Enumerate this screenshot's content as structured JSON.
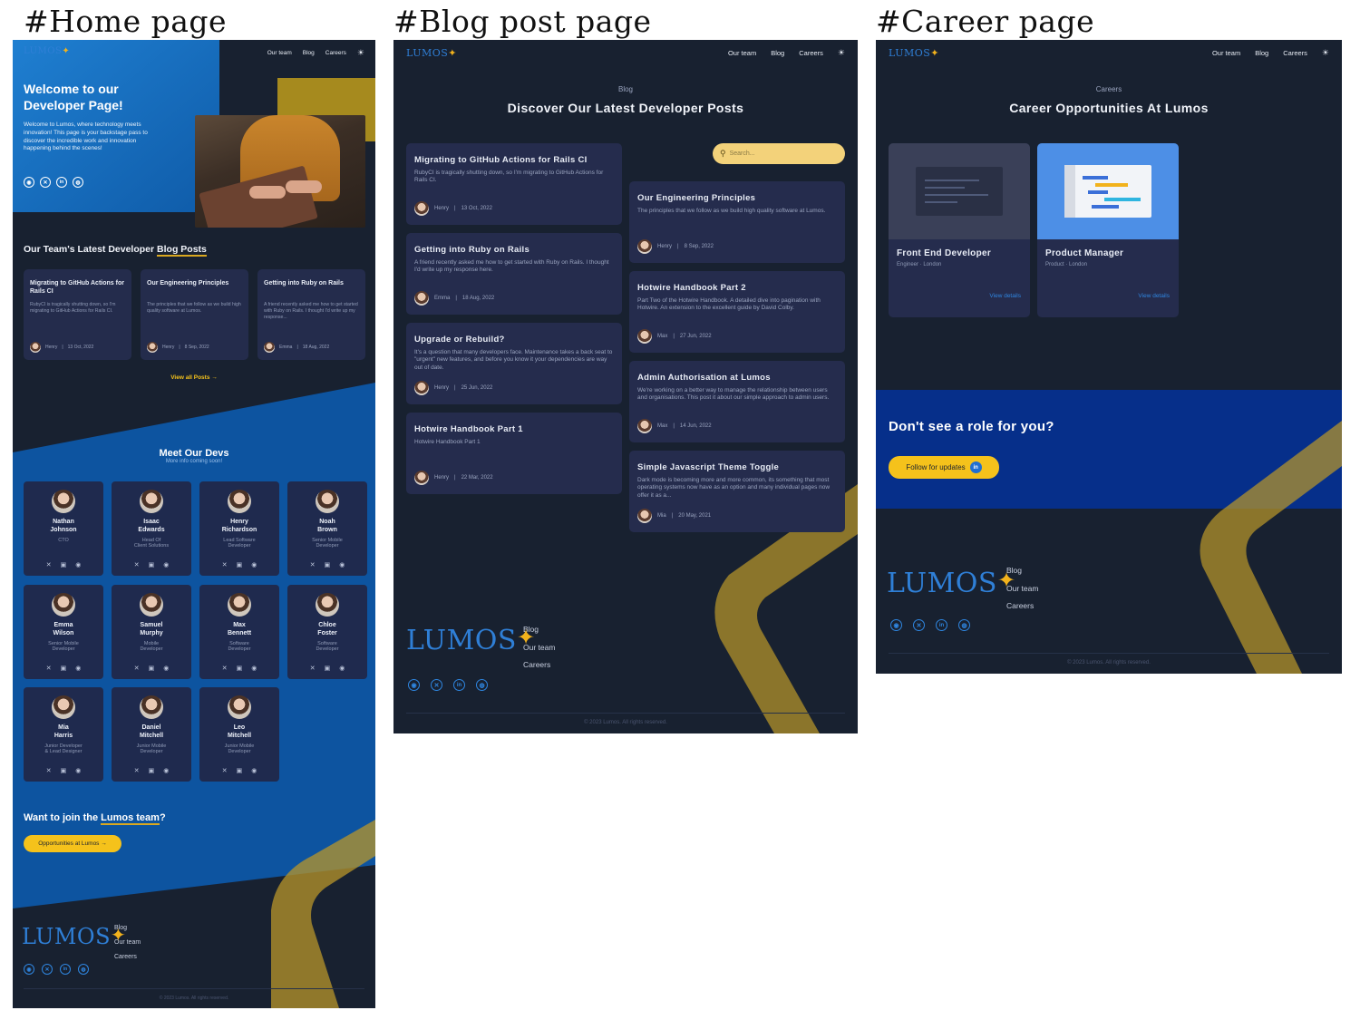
{
  "captions": {
    "home": "#Home page",
    "blog": "#Blog post page",
    "career": "#Career page"
  },
  "nav": {
    "our_team": "Our team",
    "blog": "Blog",
    "careers": "Careers",
    "theme_icon": "sun-icon"
  },
  "logo": {
    "text": "LUMOS",
    "star": "✦"
  },
  "home": {
    "hero_title_1": "Welcome to our",
    "hero_title_2": "Developer Page!",
    "hero_text": "Welcome to Lumos, where technology meets innovation! This page is your backstage pass to discover the incredible work and innovation happening behind the scenes!",
    "posts_heading_prefix": "Our Team's Latest Developer ",
    "posts_heading_highlight": "Blog Posts",
    "posts": [
      {
        "title": "Migrating to GitHub Actions for Rails CI",
        "excerpt": "RubyCI is tragically shutting down, so I'm migrating to GitHub Actions for Rails CI.",
        "author": "Henry",
        "date": "13 Oct, 2022"
      },
      {
        "title": "Our Engineering Principles",
        "excerpt": "The principles that we follow as we build high quality software at Lumos.",
        "author": "Henry",
        "date": "8 Sep, 2022"
      },
      {
        "title": "Getting into Ruby on Rails",
        "excerpt": "A friend recently asked me how to get started with Ruby on Rails. I thought I'd write up my response...",
        "author": "Emma",
        "date": "18 Aug, 2022"
      }
    ],
    "view_all": "View all Posts →",
    "devs_heading": "Meet Our Devs",
    "devs_subheading": "More info coming soon!",
    "devs": [
      {
        "first": "Nathan",
        "last": "Johnson",
        "role1": "CTO",
        "role2": ""
      },
      {
        "first": "Isaac",
        "last": "Edwards",
        "role1": "Head Of",
        "role2": "Client Solutions"
      },
      {
        "first": "Henry",
        "last": "Richardson",
        "role1": "Lead Software",
        "role2": "Developer"
      },
      {
        "first": "Noah",
        "last": "Brown",
        "role1": "Senior Mobile",
        "role2": "Developer"
      },
      {
        "first": "Emma",
        "last": "Wilson",
        "role1": "Senior Mobile",
        "role2": "Developer"
      },
      {
        "first": "Samuel",
        "last": "Murphy",
        "role1": "Mobile",
        "role2": "Developer"
      },
      {
        "first": "Max",
        "last": "Bennett",
        "role1": "Software",
        "role2": "Developer"
      },
      {
        "first": "Chloe",
        "last": "Foster",
        "role1": "Software",
        "role2": "Developer"
      },
      {
        "first": "Mia",
        "last": "Harris",
        "role1": "Junior Developer",
        "role2": "& Lead Designer"
      },
      {
        "first": "Daniel",
        "last": "Mitchell",
        "role1": "Junior Mobile",
        "role2": "Developer"
      },
      {
        "first": "Leo",
        "last": "Mitchell",
        "role1": "Junior Mobile",
        "role2": "Developer"
      }
    ],
    "dev_icons": [
      "x-icon",
      "linkedin-icon",
      "github-icon"
    ],
    "join_prefix": "Want to join the ",
    "join_highlight": "Lumos team",
    "join_suffix": "?",
    "join_button": "Opportunities at Lumos →"
  },
  "blog": {
    "eyebrow": "Blog",
    "heading": "Discover Our Latest Developer Posts",
    "search_placeholder": "Search...",
    "left_posts": [
      {
        "title": "Migrating to GitHub Actions for Rails CI",
        "excerpt": "RubyCI is tragically shutting down, so I'm migrating to GitHub Actions for Rails CI.",
        "author": "Henry",
        "date": "13 Oct, 2022"
      },
      {
        "title": "Getting into Ruby on Rails",
        "excerpt": "A friend recently asked me how to get started with Ruby on Rails. I thought I'd write up my response here.",
        "author": "Emma",
        "date": "18 Aug, 2022"
      },
      {
        "title": "Upgrade or Rebuild?",
        "excerpt": "It's a question that many developers face. Maintenance takes a back seat to \"urgent\" new features, and before you know it your dependencies are way out of date.",
        "author": "Henry",
        "date": "25 Jun, 2022"
      },
      {
        "title": "Hotwire Handbook Part 1",
        "excerpt": "Hotwire Handbook Part 1",
        "author": "Henry",
        "date": "22 Mar, 2022"
      }
    ],
    "right_posts": [
      {
        "title": "Our Engineering Principles",
        "excerpt": "The principles that we follow as we build high quality software at Lumos.",
        "author": "Henry",
        "date": "8 Sep, 2022"
      },
      {
        "title": "Hotwire Handbook Part 2",
        "excerpt": "Part Two of the Hotwire Handbook. A detailed dive into pagination with Hotwire. An extension to the excellent guide by David Colby.",
        "author": "Max",
        "date": "27 Jun, 2022"
      },
      {
        "title": "Admin Authorisation at Lumos",
        "excerpt": "We're working on a better way to manage the relationship between users and organisations. This post it about our simple approach to admin users.",
        "author": "Max",
        "date": "14 Jun, 2022"
      },
      {
        "title": "Simple Javascript Theme Toggle",
        "excerpt": "Dark mode is becoming more and more common, its something that most operating systems now have as an option and many individual pages now offer it as a...",
        "author": "Mia",
        "date": "20 May, 2021"
      }
    ]
  },
  "career": {
    "eyebrow": "Careers",
    "heading": "Career Opportunities At Lumos",
    "jobs": [
      {
        "title": "Front End Developer",
        "meta": "Engineer · London",
        "link": "View details"
      },
      {
        "title": "Product Manager",
        "meta": "Product · London",
        "link": "View details"
      }
    ],
    "cta_heading": "Don't see a role for you?",
    "cta_button": "Follow for updates"
  },
  "footer": {
    "links": [
      "Blog",
      "Our team",
      "Careers"
    ],
    "social_icons": [
      "github-icon",
      "x-icon",
      "linkedin-icon",
      "globe-icon"
    ],
    "copyright": "© 2023 Lumos. All rights reserved."
  },
  "colors": {
    "page_bg": "#182130",
    "hero_blue": "#1a74c7",
    "section_blue": "#0d54a0",
    "card_bg": "#252c4d",
    "accent_yellow": "#f5c21b",
    "logo_blue": "#2f7fd6"
  }
}
